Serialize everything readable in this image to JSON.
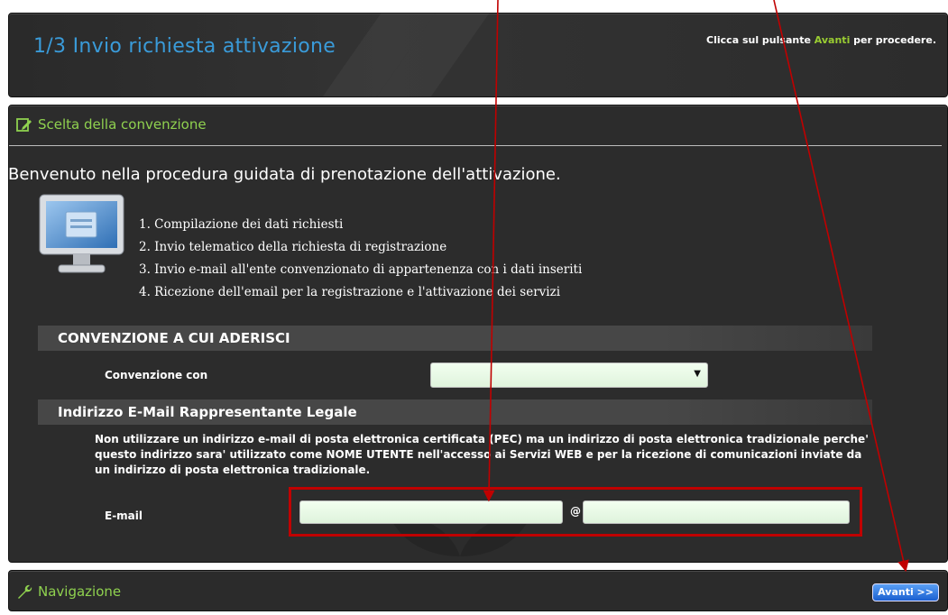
{
  "header": {
    "title": "1/3 Invio richiesta attivazione",
    "hint_prefix": "Clicca sul pulsante ",
    "hint_highlight": "Avanti",
    "hint_suffix": " per procedere."
  },
  "section": {
    "title": "Scelta della convenzione",
    "icon": "edit-icon"
  },
  "welcome": "Benvenuto nella procedura guidata di prenotazione dell'attivazione.",
  "steps": [
    "1.  Compilazione dei dati richiesti",
    "2.  Invio telematico della richiesta di registrazione",
    "3.  Invio e-mail all'ente convenzionato di appartenenza con i dati inseriti",
    "4.  Ricezione dell'email per la registrazione e l'attivazione dei servizi"
  ],
  "convention": {
    "heading": "CONVENZIONE A CUI ADERISCI",
    "label": "Convenzione con",
    "selected": ""
  },
  "email": {
    "heading": "Indirizzo E-Mail Rappresentante Legale",
    "notice": "Non utilizzare un indirizzo e-mail di posta elettronica certificata (PEC) ma un indirizzo di posta elettronica tradizionale perche' questo indirizzo sara' utilizzato come NOME UTENTE nell'accesso ai Servizi WEB e per la ricezione di comunicazioni inviate da un indirizzo di posta elettronica tradizionale.",
    "label": "E-mail",
    "at": "@",
    "local_value": "",
    "domain_value": ""
  },
  "navigation": {
    "title": "Navigazione",
    "icon": "wrench-icon",
    "next_label": "Avanti >>"
  },
  "colors": {
    "accent_blue": "#3a9bd9",
    "accent_green": "#8fd14f",
    "highlight_red": "#c00000",
    "arrow_red": "#c00000"
  }
}
